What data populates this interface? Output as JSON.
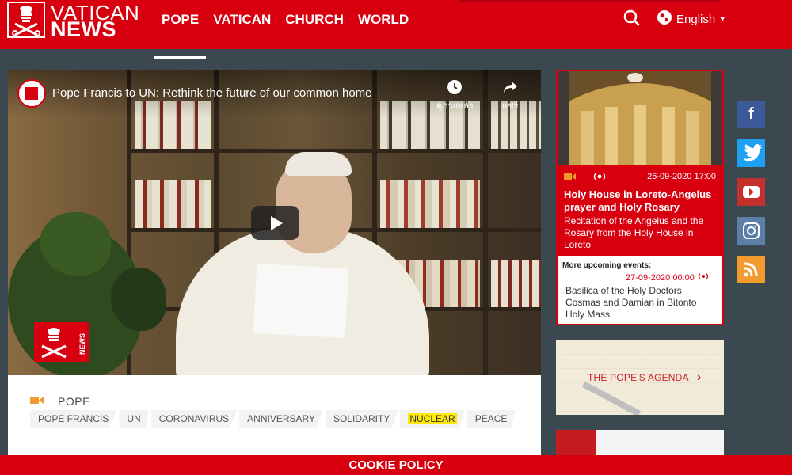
{
  "header": {
    "logo_line1": "VATICAN",
    "logo_line2": "NEWS",
    "nav": [
      {
        "label": "POPE",
        "active": true
      },
      {
        "label": "VATICAN"
      },
      {
        "label": "CHURCH"
      },
      {
        "label": "WORLD"
      }
    ],
    "language": "English",
    "icons": {
      "search": "search-icon",
      "globe": "globe-icon"
    }
  },
  "video": {
    "title": "Pope Francis to UN: Rethink the future of our common home",
    "watch_later_label": "ดูภายหลัง",
    "share_label": "แชร์",
    "badge_text": "NEWS"
  },
  "article": {
    "category": "POPE",
    "tags": [
      "POPE FRANCIS",
      "UN",
      "CORONAVIRUS",
      "ANNIVERSARY",
      "SOLIDARITY",
      "NUCLEAR",
      "PEACE"
    ],
    "highlighted_tag": "NUCLEAR"
  },
  "events": {
    "featured": {
      "datetime": "26-09-2020 17:00",
      "title": "Holy House in Loreto-Angelus prayer and Holy Rosary",
      "description": "Recitation of the Angelus and the Rosary from the Holy House in Loreto"
    },
    "more_label": "More upcoming events:",
    "next": {
      "datetime": "27-09-2020 00:00",
      "description": "Basilica of the Holy Doctors Cosmas and Damian in Bitonto Holy Mass"
    }
  },
  "agenda": {
    "label": "THE POPE'S AGENDA",
    "arrow": "›"
  },
  "social": [
    {
      "name": "facebook",
      "glyph": "f"
    },
    {
      "name": "twitter",
      "glyph": ""
    },
    {
      "name": "youtube",
      "glyph": ""
    },
    {
      "name": "instagram",
      "glyph": ""
    },
    {
      "name": "rss",
      "glyph": ""
    }
  ],
  "cookie": {
    "label": "COOKIE POLICY"
  },
  "colors": {
    "brand_red": "#d8000f",
    "page_bg": "#3c4850",
    "tag_highlight": "#ffe90a"
  }
}
